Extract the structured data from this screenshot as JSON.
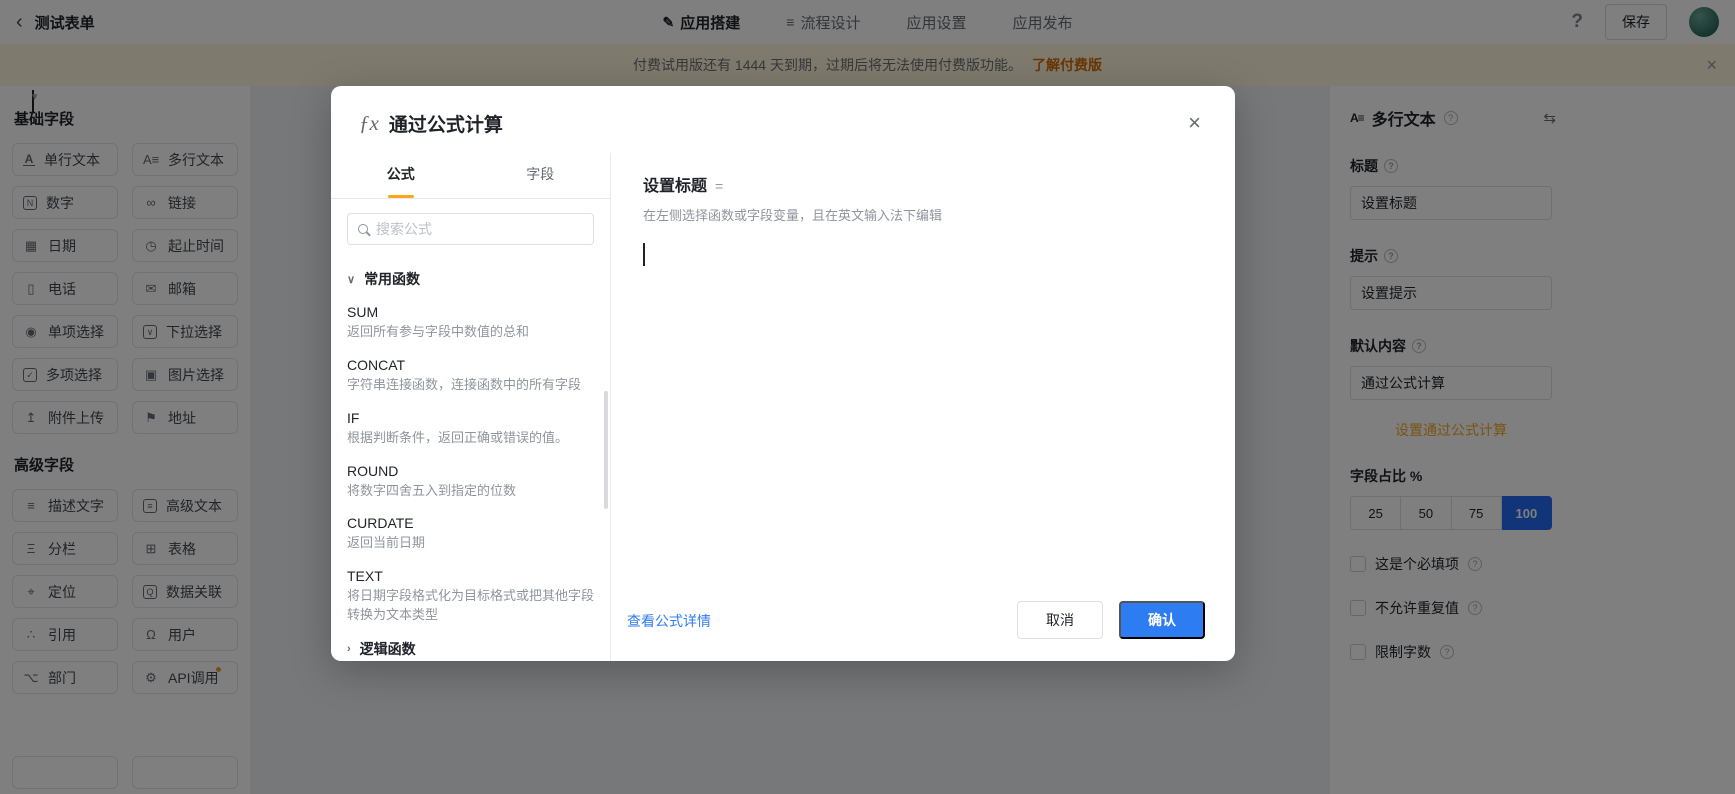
{
  "icons": {
    "back": "‹",
    "close": "×",
    "help": "?",
    "swap": "⇆",
    "caret": "▾",
    "chevron_down": "∨",
    "chevron_right": "›"
  },
  "topbar": {
    "form_title": "测试表单",
    "tabs": [
      {
        "label": "应用搭建",
        "glyph": "✎",
        "active": true
      },
      {
        "label": "流程设计",
        "glyph": "≡",
        "active": false
      },
      {
        "label": "应用设置",
        "active": false
      },
      {
        "label": "应用发布",
        "active": false
      }
    ],
    "help_label": "?",
    "save_label": "保存"
  },
  "banner": {
    "text": "付费试用版还有 1444 天到期，过期后将无法使用付费版功能。",
    "link": "了解付费版"
  },
  "left_sidebar": {
    "sections": [
      {
        "title": "基础字段",
        "items": [
          {
            "name": "single-line-text",
            "label": "单行文本",
            "glyph": "A"
          },
          {
            "name": "multi-line-text",
            "label": "多行文本",
            "glyph": "A≡"
          },
          {
            "name": "number",
            "label": "数字",
            "glyph": "N",
            "boxed": true
          },
          {
            "name": "link",
            "label": "链接",
            "glyph": "∞"
          },
          {
            "name": "date",
            "label": "日期",
            "glyph": "▦"
          },
          {
            "name": "date-range",
            "label": "起止时间",
            "glyph": "◷"
          },
          {
            "name": "phone",
            "label": "电话",
            "glyph": "▯"
          },
          {
            "name": "email",
            "label": "邮箱",
            "glyph": "✉"
          },
          {
            "name": "radio-select",
            "label": "单项选择",
            "glyph": "◉"
          },
          {
            "name": "dropdown-select",
            "label": "下拉选择",
            "glyph": "∨",
            "boxed": true
          },
          {
            "name": "checkbox-select",
            "label": "多项选择",
            "glyph": "✓",
            "boxed": true
          },
          {
            "name": "image-select",
            "label": "图片选择",
            "glyph": "▣"
          },
          {
            "name": "attachment-upload",
            "label": "附件上传",
            "glyph": "↥"
          },
          {
            "name": "address",
            "label": "地址",
            "glyph": "⚑"
          }
        ]
      },
      {
        "title": "高级字段",
        "items": [
          {
            "name": "description-text",
            "label": "描述文字",
            "glyph": "≡"
          },
          {
            "name": "rich-text",
            "label": "高级文本",
            "glyph": "≡",
            "boxed": true
          },
          {
            "name": "columns",
            "label": "分栏",
            "glyph": "Ξ"
          },
          {
            "name": "table",
            "label": "表格",
            "glyph": "⊞"
          },
          {
            "name": "location",
            "label": "定位",
            "glyph": "⌖"
          },
          {
            "name": "data-link",
            "label": "数据关联",
            "glyph": "Q",
            "boxed": true
          },
          {
            "name": "reference",
            "label": "引用",
            "glyph": "∴"
          },
          {
            "name": "user",
            "label": "用户",
            "glyph": "Ω"
          },
          {
            "name": "department",
            "label": "部门",
            "glyph": "⌥"
          },
          {
            "name": "api-call",
            "label": "API调用",
            "glyph": "⚙",
            "badge": true
          }
        ]
      }
    ]
  },
  "modal": {
    "fx_glyph": "ƒx",
    "title": "通过公式计算",
    "tabs": [
      {
        "label": "公式",
        "active": true
      },
      {
        "label": "字段",
        "active": false
      }
    ],
    "search": {
      "placeholder": "搜索公式"
    },
    "group_common": {
      "label": "常用函数"
    },
    "group_logic": {
      "label": "逻辑函数"
    },
    "functions": [
      {
        "name": "SUM",
        "desc": "返回所有参与字段中数值的总和"
      },
      {
        "name": "CONCAT",
        "desc": "字符串连接函数，连接函数中的所有字段"
      },
      {
        "name": "IF",
        "desc": "根据判断条件，返回正确或错误的值。"
      },
      {
        "name": "ROUND",
        "desc": "将数字四舍五入到指定的位数"
      },
      {
        "name": "CURDATE",
        "desc": "返回当前日期"
      },
      {
        "name": "TEXT",
        "desc": "将日期字段格式化为目标格式或把其他字段转换为文本类型"
      }
    ],
    "editor": {
      "title": "设置标题",
      "equals": "=",
      "hint": "在左侧选择函数或字段变量，且在英文输入法下编辑"
    },
    "footer": {
      "detail_link": "查看公式详情",
      "cancel_label": "取消",
      "confirm_label": "确认"
    }
  },
  "right_sidebar": {
    "header": {
      "icon_glyph": "A≡",
      "title": "多行文本"
    },
    "fields": {
      "title": {
        "label": "标题",
        "value": "设置标题"
      },
      "hint": {
        "label": "提示",
        "value": "设置提示"
      },
      "default": {
        "label": "默认内容",
        "value": "通过公式计算"
      }
    },
    "action_link": "设置通过公式计算",
    "ratio": {
      "label": "字段占比 %",
      "options": [
        "25",
        "50",
        "75",
        "100"
      ],
      "selected": "100"
    },
    "checkboxes": [
      {
        "label": "这是个必填项"
      },
      {
        "label": "不允许重复值"
      },
      {
        "label": "限制字数"
      }
    ]
  },
  "colors": {
    "accent_blue": "#2e7cf2",
    "segment_blue": "#2468f2",
    "tab_underline_orange": "#f9a61a",
    "action_orange": "#f5a623",
    "banner_bg": "#fdf4dc",
    "banner_link_orange": "#d46b08"
  }
}
